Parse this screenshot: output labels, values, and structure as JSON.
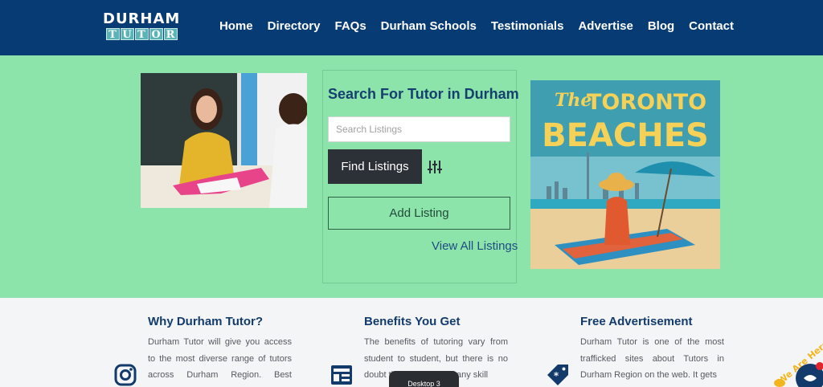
{
  "logo": {
    "top": "DURHAM",
    "bottom_letters": [
      "T",
      "U",
      "T",
      "O",
      "R"
    ]
  },
  "nav": {
    "items": [
      "Home",
      "Directory",
      "FAQs",
      "Durham Schools",
      "Testimonials",
      "Advertise",
      "Blog",
      "Contact"
    ]
  },
  "search": {
    "title": "Search For Tutor in Durham",
    "placeholder": "Search Listings",
    "find_label": "Find Listings",
    "add_label": "Add Listing",
    "view_all": "View All Listings"
  },
  "ad": {
    "line1": "The",
    "line2": "TORONTO",
    "line3": "BEACHES"
  },
  "features": [
    {
      "title": "Why Durham Tutor?",
      "text": "Durham Tutor will give you access to the most diverse range of tutors across Durham Region. Best profiles",
      "icon": "instagram-icon"
    },
    {
      "title": "Benefits You Get",
      "text": "The benefits of tutoring vary from student to student, but there is no doubt that tutoring is of any skill",
      "icon": "newspaper-icon"
    },
    {
      "title": "Free Advertisement",
      "text": "Durham Tutor is one of the most trafficked sites about Tutors in Durham Region on the web. It gets",
      "icon": "tag-icon"
    }
  ],
  "desktop_tooltip": "Desktop 3",
  "chat_widget": {
    "text": "We Are Here"
  },
  "colors": {
    "header": "#073b73",
    "hero": "#8de4ab",
    "button_dark": "#2c3138",
    "title_blue": "#153f6e"
  }
}
